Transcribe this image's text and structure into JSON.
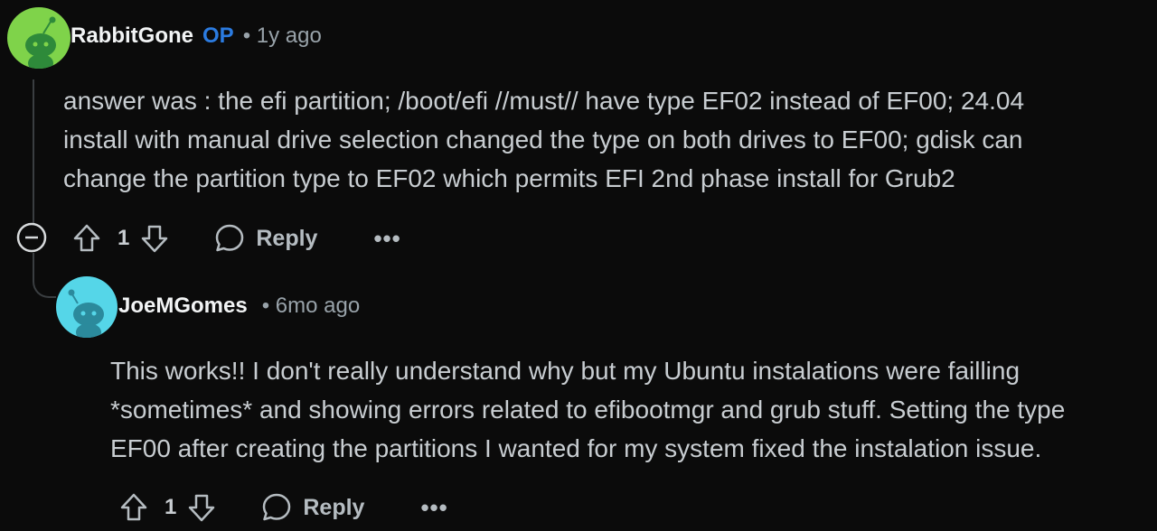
{
  "colors": {
    "background": "#0b0b0b",
    "op_badge": "#2b7be0",
    "avatar1_bg": "#7fd34a",
    "avatar2_bg": "#55d6e8"
  },
  "comments": [
    {
      "author": "RabbitGone",
      "badge": "OP",
      "meta": "• 1y ago",
      "avatar_icon": "snoo-avatar-icon",
      "body": [
        "answer was : the efi partition; /boot/efi //must// have type EF02 instead of EF00; 24.04",
        "install with manual drive selection changed the type on both drives to EF00; gdisk can",
        "change the partition type to EF02 which permits EFI 2nd phase install for Grub2"
      ],
      "votes": "1",
      "reply_label": "Reply",
      "more": "•••"
    },
    {
      "author": "JoeMGomes",
      "meta": "• 6mo ago",
      "avatar_icon": "snoo-avatar-icon",
      "body": [
        "This works!! I don't really understand why but my Ubuntu instalations were failling",
        "*sometimes* and showing errors related to efibootmgr and grub stuff. Setting the type",
        "EF00 after creating the partitions I wanted for my system fixed the instalation issue."
      ],
      "votes": "1",
      "reply_label": "Reply",
      "more": "•••"
    }
  ]
}
